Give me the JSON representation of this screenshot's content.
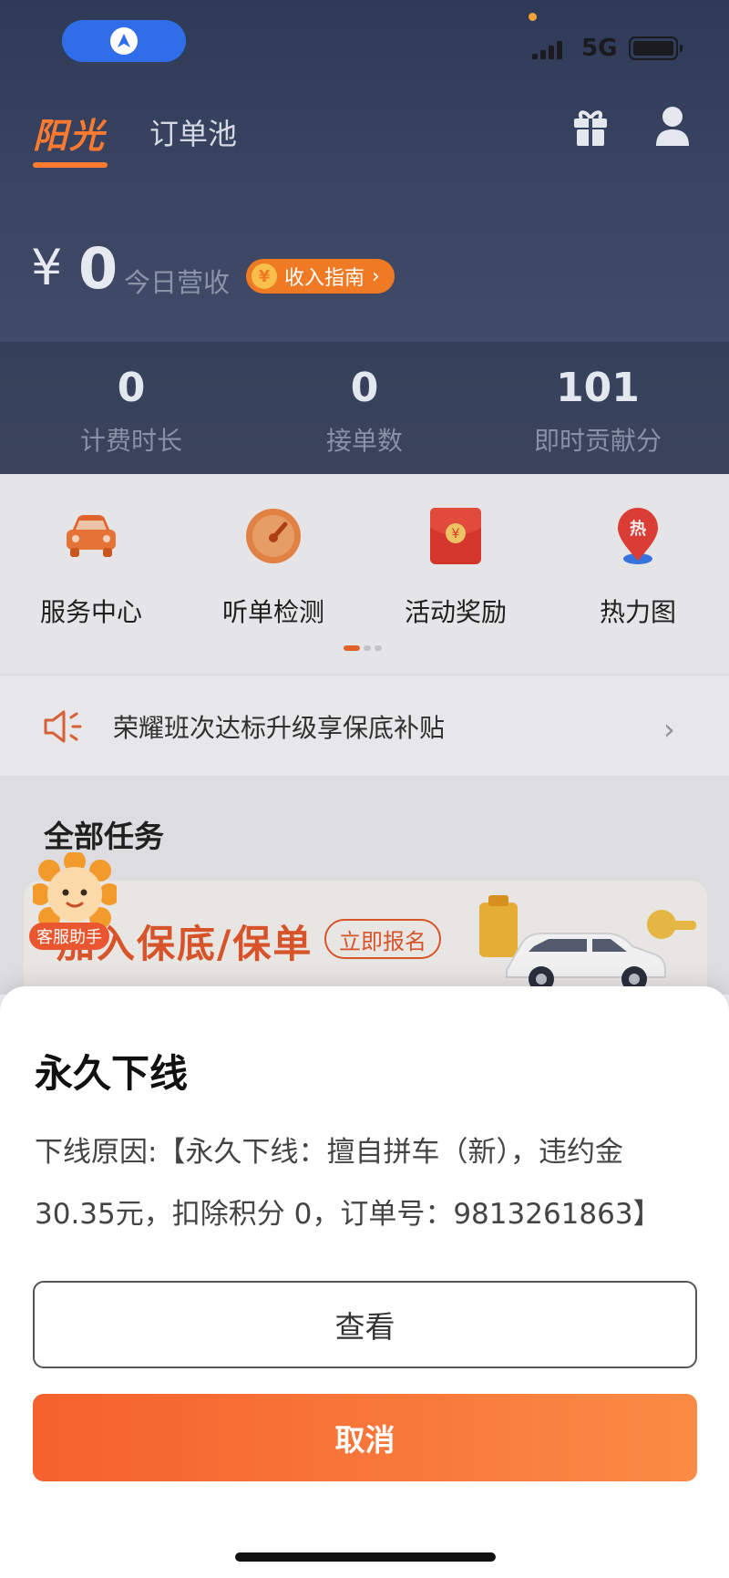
{
  "status_bar": {
    "network": "5G"
  },
  "header": {
    "brand_tab": "阳光",
    "pool_tab": "订单池",
    "currency": "¥",
    "income_value": "0",
    "income_label": "今日营收",
    "income_guide": "收入指南",
    "income_guide_coin": "¥",
    "income_guide_arrow": "›"
  },
  "stats": [
    {
      "value": "0",
      "label": "计费时长"
    },
    {
      "value": "0",
      "label": "接单数"
    },
    {
      "value": "101",
      "label": "即时贡献分"
    }
  ],
  "grid": [
    {
      "label": "服务中心",
      "icon": "car-icon"
    },
    {
      "label": "听单检测",
      "icon": "gauge-icon"
    },
    {
      "label": "活动奖励",
      "icon": "red-envelope-icon",
      "glyph": "¥"
    },
    {
      "label": "热力图",
      "icon": "heat-pin-icon",
      "glyph": "热"
    }
  ],
  "notice": {
    "text": "荣耀班次达标升级享保底补贴",
    "arrow": "›"
  },
  "tasks": {
    "title": "全部任务",
    "banner_text": "加入保底/保单",
    "banner_button": "立即报名"
  },
  "mascot": {
    "tag": "客服助手"
  },
  "sheet": {
    "title": "永久下线",
    "body": "下线原因:【永久下线：擅自拼车（新），违约金30.35元，扣除积分 0，订单号：9813261863】",
    "view_button": "查看",
    "cancel_button": "取消"
  },
  "colors": {
    "accent": "#f5612d",
    "header_bg": "#2e3a57",
    "status_pill": "#2f6ee8"
  }
}
